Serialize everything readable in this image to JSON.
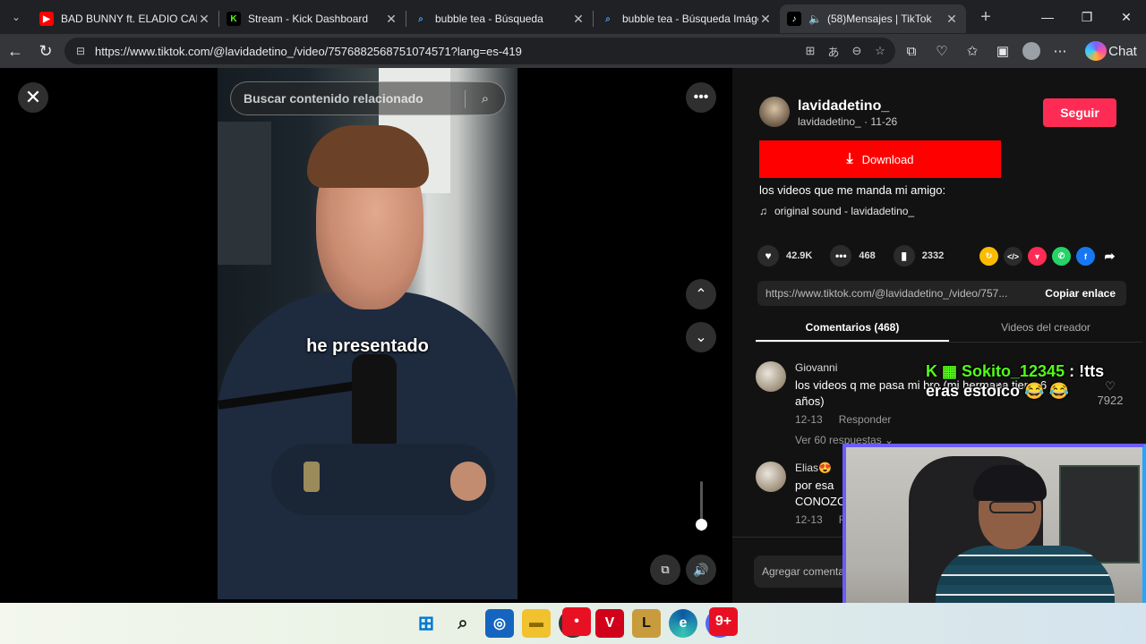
{
  "browser": {
    "tabs": [
      {
        "title": "BAD BUNNY ft. ELADIO CARRIÓN",
        "favicon": "youtube-icon",
        "color": "#ff0000"
      },
      {
        "title": "Stream - Kick Dashboard",
        "favicon": "kick-icon",
        "color": "#53fc18"
      },
      {
        "title": "bubble tea - Búsqueda",
        "favicon": "bing-search-icon",
        "color": "#1a73e8"
      },
      {
        "title": "bubble tea - Búsqueda Imágenes",
        "favicon": "bing-search-icon",
        "color": "#1a73e8"
      },
      {
        "title": "(58)Mensajes | TikTok",
        "favicon": "tiktok-icon",
        "color": "#ffffff"
      }
    ],
    "url": "https://www.tiktok.com/@lavidadetino_/video/7576882568751074571?lang=es-419",
    "chat_label": "Chat"
  },
  "video": {
    "search_placeholder": "Buscar contenido relacionado",
    "caption": "he presentado",
    "volume_level": 0.15
  },
  "panel": {
    "author": {
      "name": "lavidadetino_",
      "handle": "lavidadetino_",
      "date": "11-26"
    },
    "follow_label": "Seguir",
    "download_label": "Download",
    "description": "los videos que me manda mi amigo:",
    "sound": "original sound - lavidadetino_",
    "likes": "42.9K",
    "comments_count": "468",
    "saves": "2332",
    "link": "https://www.tiktok.com/@lavidadetino_/video/757...",
    "copy_label": "Copiar enlace",
    "tab_comments": "Comentarios (468)",
    "tab_creator": "Videos del creador",
    "comments": [
      {
        "user": "Giovanni",
        "text": "los videos q me pasa mi bro (mi hermana tiene 6 años)",
        "date": "12-13",
        "reply": "Responder",
        "replies": "Ver 60 respuestas ⌄",
        "likes": "7922"
      },
      {
        "user": "Elias😍",
        "text": "por esa CONOZC",
        "date": "12-13",
        "reply": "R"
      }
    ],
    "add_comment_placeholder": "Agregar comentario..."
  },
  "stream_overlay": {
    "chat_user": "Sokito_12345",
    "chat_msg": ": !tts eras estoico 😂 😂"
  },
  "colors": {
    "accent": "#fe2c55",
    "download": "#fe0000",
    "kick": "#53fc18"
  }
}
